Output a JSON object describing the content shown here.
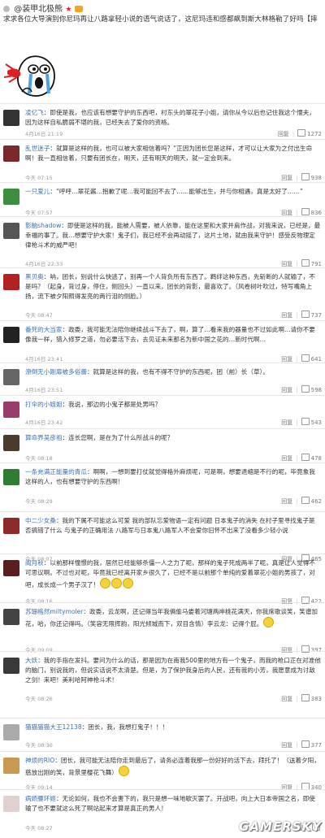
{
  "post": {
    "username": "@装甲北极熊",
    "text": "求求各位大导演别你尼玛再让八路拿轻小说的语气说话了，这尼玛违和感都飙到斯大林格勒了好吗【摔"
  },
  "comments": [
    {
      "user": "凌亿飞",
      "text": "：即使是我，也应该有想要守护的东西吧，村东头的翠花子小姐，请你从今以后也记住我这个懦夫，因为这样自私脆弱不堪的我，已经失去了爱你的资格。",
      "time": "4月16日 21:19",
      "likes": "1272",
      "avatar": "#333333"
    },
    {
      "user": "乱世迷子",
      "text": "：就算是这样的我，也可以被大家相信着吗？”正因为团长您是这样，才可以让大家为之付出生命啊！我一直相信着，只要有团长在，明天，还有明天的明天，就一定会到来。",
      "time": "今天 07:15",
      "likes": "938",
      "avatar": "#7a2a2a"
    },
    {
      "user": "一只爱儿",
      "text": "：“呼呼…翠花酱…抱歉了呢…我可能回不去了……能够出生，并与你相遇，真是太好了……”",
      "time": "今天 07:57",
      "likes": "836",
      "avatar": "#3c8f3c"
    },
    {
      "user": "影脑shadow",
      "text": "：即使是这样的我，能被人需要，被人依靠，能在这里和大家并肩作战，对我来说，已经是，最幸福的事了。我…想要守护大家！鬼子们，我已经不会再动摇了，这片土地，就由我来守护！感受反物理定律枪斗术的威严吧！",
      "time": "4月16日 22:33",
      "likes": "791",
      "avatar": "#555555"
    },
    {
      "user": "黑贝奥",
      "text": "：呐，团长，别说什么快逃了，别再一个人背负所有东西了。羁绊这种东西，先斩断的人就输了，不是吗？（起身，背过身，停住，侧回头）一直以来，团长的背影，最喜欢了。（风卷树叶吹过，特写嘴角上扬，流下被夕阳照得发亮的两行泪的侧脸。）",
      "time": "今天 08:47",
      "likes": "737",
      "avatar": "#b22222"
    },
    {
      "user": "番死的大当家",
      "text": "：政委，我可能无法陪你继续战斗下去了，啊，算了…看来我的器量也不过如此啊…请你不要像我一样，猎入修罗之道，勿必要活下去，去见证未来那名为新中国之花的…新时代啊…",
      "time": "4月16日 23:41",
      "likes": "641",
      "avatar": "#222222"
    },
    {
      "user": "潦倒无小刚扉被多俗蕾",
      "text": "：就算是这样的我，也有不得不守护的东西呢，团（前）长（草）。",
      "time": "4月16日 23:51",
      "likes": "598",
      "avatar": "#666666"
    },
    {
      "user": "打伞的小姐姐",
      "text": "：我说，那边的小鬼子都是处男吗？",
      "time": "4月16日 23:42",
      "likes": "543",
      "avatar": "#9a3b6b"
    },
    {
      "user": "算命界吴彦祖",
      "text": "：连长您啊，是在为了什么所战斗的呢？",
      "time": "今天 08:18",
      "likes": "478",
      "avatar": "#4b3b2b"
    },
    {
      "user": "一条充满正能量的青瓜",
      "text": "：啊啊，一想到要打仗就觉得格外麻烦呢，可是啊，想要退缩是不行的呢，毕竟象我这样的人，也有想要守护的东西啊！",
      "time": "今天 08:29",
      "likes": "462",
      "avatar": "#2f7d32"
    },
    {
      "user": "中二少女桑",
      "text": "：我的下属不可能这么可爱 我的部队忘爱物语一定有问题 日本鬼子的消失 在村子里寻找鬼子是否搞错了什么 与鬼子的正确用法 八路军与日本鬼八路军人不会爱你旧怀不出来了没看多少轻小说",
      "time": "今天 08:07",
      "likes": "465",
      "avatar": "#8e2a2a"
    },
    {
      "user": "阁月秋",
      "text": "：以前那样憧憬的我，居然已经能够杀僵一人之力了呢，那样的鬼子死成两半了呢，真是让人觉得不可思议啊。不过也对呢，毕竟我已经离开家乡很久了，已经不是以前那个单纯的爱着翠花小姐的男孩了，对吧，成长成一个男子汉了！",
      "time": "今天 08:16",
      "likes": "422",
      "avatar": "#5a1e1e",
      "emojis": 3
    },
    {
      "user": "苏珊格然miltymoler",
      "text": "：政委，云龙啊，还记得当年我俩偷马娄着河塘两岸桃花满天，你我席歌谈笑，笑谱加花，哈，你还记得吗。（笑容无限挥韵，阳光倾城而下，双目含情）李云龙：记得个屁。",
      "time": "今天 09:09",
      "likes": "397",
      "avatar": "#444444",
      "emojis": 1
    },
    {
      "user": "大妖",
      "text": "：我的手指在发抖。要问为什么的话，那是因为在南我500里的地方有一个鬼子，而我的枪口正在对准他的脑门，别说我的，但说实话说不太清楚。但是，为了保护我身后的人民，还有我的小芳，我愿意成为讨敌之剑！来吧！美利哈阿神枪斗术！",
      "time": "今天 08:26",
      "likes": "383",
      "avatar": "#3a3a3a"
    },
    {
      "user": "猫猫猫猫大王12138",
      "text": "：团长，我，我想打鬼子！！！",
      "time": "今天 08:30",
      "likes": "377",
      "avatar": "#aaaaaa"
    },
    {
      "user": "神烦的RIO",
      "text": "：团长，我可能无法陪你走到最后了，请务必连着我那一份好好的活下去，拜托了！（送着夕阳，慈放出刚的笑，背景里樱花飞舞）",
      "time": "今天 09:14",
      "likes": "340",
      "avatar": "#c89a50",
      "emojis": 1
    },
    {
      "user": "病娇腰环姬",
      "text": "：无论如何，我也不会害下的，我只是想一味地歇灭罢了。开战吧，向上大日本帝国之名，即使输了也不要就这么死了啊站起来才算是真正的男人！",
      "time": "今天 08:27",
      "likes": "",
      "avatar": "#e0d0d0"
    }
  ],
  "actions": {
    "reply": "回复",
    "report": "举报"
  },
  "watermark": "GAMERSKY"
}
